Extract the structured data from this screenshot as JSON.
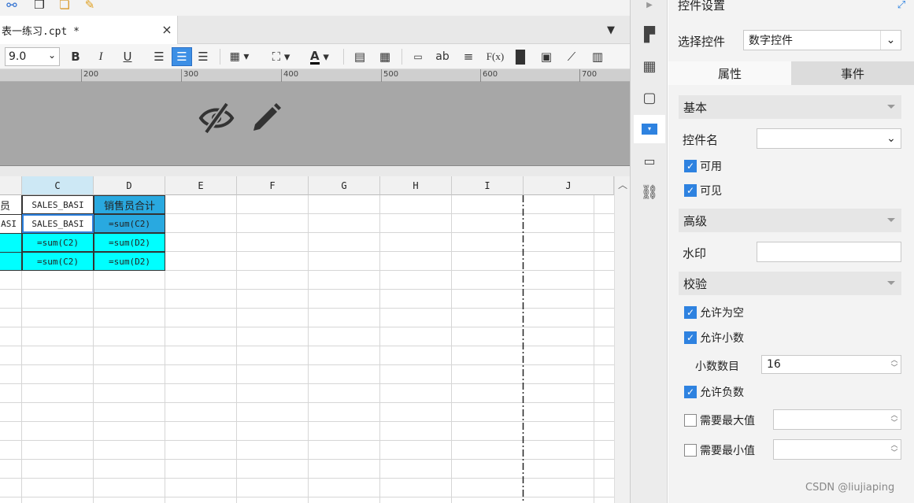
{
  "tab": {
    "title": "表一练习.cpt *",
    "close": "×"
  },
  "toolbar": {
    "font_size": "9.0",
    "bold": "B",
    "italic": "I",
    "underline": "U",
    "text_color": "A",
    "ab": "ab",
    "formula": "F(x)"
  },
  "ruler": {
    "labels": [
      "200",
      "300",
      "400",
      "500",
      "600",
      "700"
    ]
  },
  "grid": {
    "columns": [
      "C",
      "D",
      "E",
      "F",
      "G",
      "H",
      "I",
      "J"
    ],
    "row1": {
      "b": "员",
      "c": "SALES_BASI",
      "d": "销售员合计"
    },
    "row2": {
      "b": "ASI",
      "c": "SALES_BASI",
      "d": "=sum(C2)"
    },
    "row3": {
      "c": "=sum(C2)",
      "d": "=sum(D2)"
    },
    "row4": {
      "c": "=sum(C2)",
      "d": "=sum(D2)"
    }
  },
  "panel": {
    "title": "控件设置",
    "select_label": "选择控件",
    "select_value": "数字控件",
    "tab_props": "属性",
    "tab_events": "事件",
    "sec_basic": "基本",
    "name_label": "控件名",
    "name_value": "",
    "enabled_label": "可用",
    "visible_label": "可见",
    "sec_advanced": "高级",
    "watermark_label": "水印",
    "sec_validation": "校验",
    "allow_empty": "允许为空",
    "allow_decimal": "允许小数",
    "decimal_digits_label": "小数数目",
    "decimal_digits_value": "16",
    "allow_negative": "允许负数",
    "need_max": "需要最大值",
    "need_min": "需要最小值"
  },
  "watermark": "CSDN @liujiaping",
  "colors": {
    "accent": "#2e82e0",
    "cyan": "#00ffff",
    "blue_cell": "#29a9e0"
  }
}
